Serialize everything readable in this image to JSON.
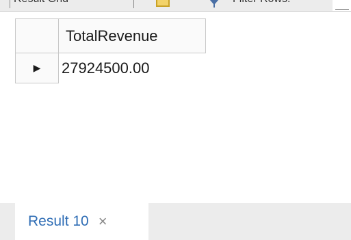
{
  "toolbar": {
    "left_text": "Result Grid",
    "right_text": "Filter Rows:",
    "icons": [
      "grid-view-icon",
      "filter-icon"
    ]
  },
  "grid": {
    "columns": [
      "TotalRevenue"
    ],
    "rows": [
      {
        "indicator": "▶",
        "cells": [
          "27924500.00"
        ]
      }
    ]
  },
  "tabs": [
    {
      "label": "Result 10",
      "close": "×",
      "accent": "#2f6db5"
    }
  ]
}
